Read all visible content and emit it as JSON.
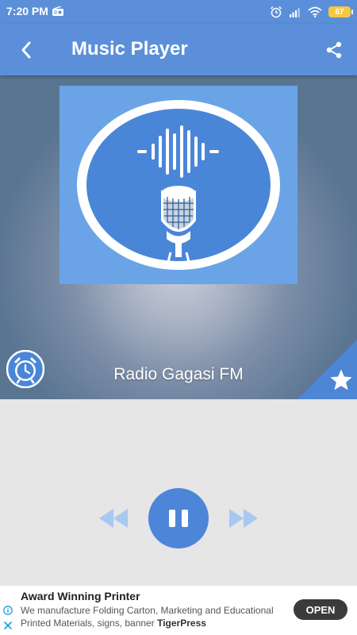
{
  "status_bar": {
    "time": "7:20 PM",
    "battery": "67"
  },
  "app_bar": {
    "title": "Music Player"
  },
  "player": {
    "station_name": "Radio Gagasi FM"
  },
  "ad": {
    "title": "Award Winning Printer",
    "description": "We manufacture Folding Carton, Marketing and Educational Printed Materials, signs, banner",
    "brand": "TigerPress",
    "cta": "OPEN"
  },
  "colors": {
    "primary": "#5b8fd9",
    "accent": "#4d86d9",
    "art_background": "#6aa4e6",
    "control_disabled": "#a9c8f0"
  }
}
